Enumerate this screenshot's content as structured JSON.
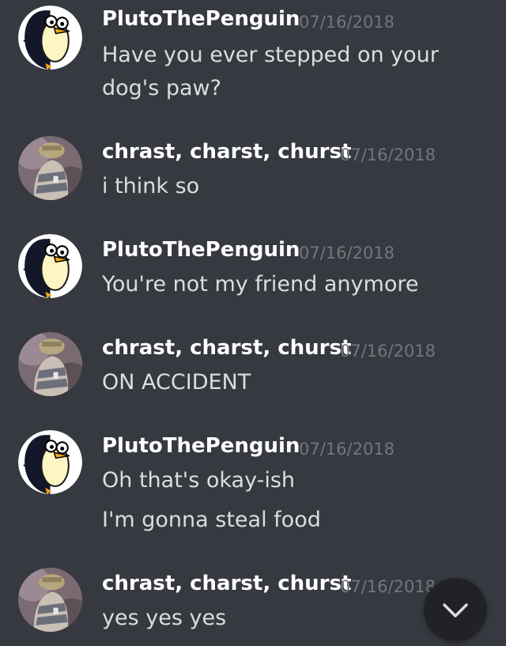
{
  "messages": [
    {
      "author": "PlutoThePenguin",
      "timestamp": "07/16/2018",
      "avatar": "penguin-avatar",
      "lines": [
        "Have you ever stepped on your",
        "dog's paw?"
      ]
    },
    {
      "author": "chrast, charst, churst",
      "timestamp": "07/16/2018",
      "avatar": "dog-photo-avatar",
      "lines": [
        "i think so"
      ]
    },
    {
      "author": "PlutoThePenguin",
      "timestamp": "07/16/2018",
      "avatar": "penguin-avatar",
      "lines": [
        "You're not my friend anymore"
      ]
    },
    {
      "author": "chrast, charst, churst",
      "timestamp": "07/16/2018",
      "avatar": "dog-photo-avatar",
      "lines": [
        "ON ACCIDENT"
      ]
    },
    {
      "author": "PlutoThePenguin",
      "timestamp": "07/16/2018",
      "avatar": "penguin-avatar",
      "lines": [
        "Oh that's okay-ish",
        "I'm gonna steal food"
      ]
    },
    {
      "author": "chrast, charst, churst",
      "timestamp": "07/16/2018",
      "avatar": "dog-photo-avatar",
      "lines": [
        "yes yes yes"
      ]
    }
  ],
  "scroll_button": {
    "icon": "chevron-down-icon"
  },
  "colors": {
    "background": "#36393f",
    "username": "#ffffff",
    "timestamp": "#72767d",
    "message_text": "#dcddde",
    "scroll_button": "#202225"
  }
}
